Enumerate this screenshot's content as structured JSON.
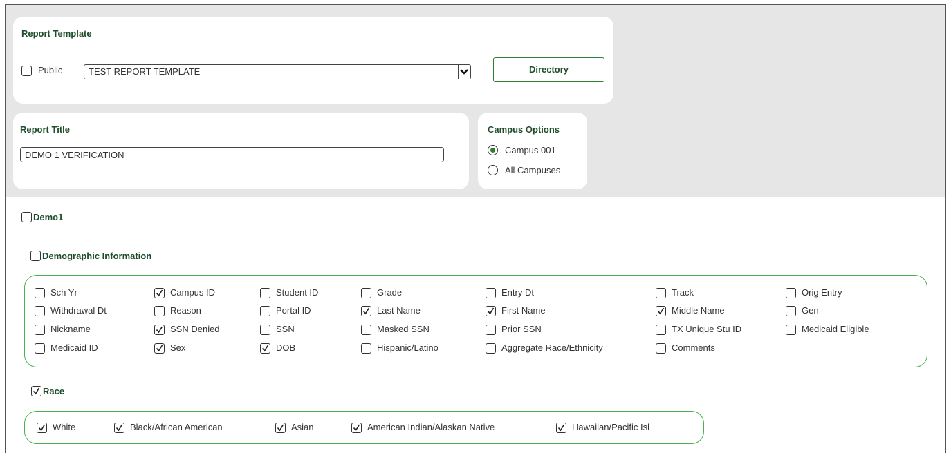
{
  "report_template": {
    "heading": "Report Template",
    "public_label": "Public",
    "public_checked": false,
    "selected_template": "TEST REPORT TEMPLATE",
    "directory_button": "Directory"
  },
  "report_title": {
    "heading": "Report Title",
    "value": "DEMO 1 VERIFICATION"
  },
  "campus_options": {
    "heading": "Campus Options",
    "options": [
      {
        "label": "Campus 001",
        "selected": true
      },
      {
        "label": "All Campuses",
        "selected": false
      }
    ]
  },
  "demo1": {
    "label": "Demo1",
    "checked": false,
    "demographic": {
      "label": "Demographic Information",
      "checked": false,
      "fields": [
        {
          "label": "Sch Yr",
          "checked": false
        },
        {
          "label": "Campus ID",
          "checked": true
        },
        {
          "label": "Student ID",
          "checked": false
        },
        {
          "label": "Grade",
          "checked": false
        },
        {
          "label": "Entry Dt",
          "checked": false
        },
        {
          "label": "Track",
          "checked": false
        },
        {
          "label": "Orig Entry",
          "checked": false
        },
        {
          "label": "Withdrawal Dt",
          "checked": false
        },
        {
          "label": "Reason",
          "checked": false
        },
        {
          "label": "Portal ID",
          "checked": false
        },
        {
          "label": "Last Name",
          "checked": true
        },
        {
          "label": "First Name",
          "checked": true
        },
        {
          "label": "Middle Name",
          "checked": true
        },
        {
          "label": "Gen",
          "checked": false
        },
        {
          "label": "Nickname",
          "checked": false
        },
        {
          "label": "SSN Denied",
          "checked": true
        },
        {
          "label": "SSN",
          "checked": false
        },
        {
          "label": "Masked SSN",
          "checked": false
        },
        {
          "label": "Prior SSN",
          "checked": false
        },
        {
          "label": "TX Unique Stu ID",
          "checked": false
        },
        {
          "label": "Medicaid Eligible",
          "checked": false
        },
        {
          "label": "Medicaid ID",
          "checked": false
        },
        {
          "label": "Sex",
          "checked": true
        },
        {
          "label": "DOB",
          "checked": true
        },
        {
          "label": "Hispanic/Latino",
          "checked": false
        },
        {
          "label": "Aggregate Race/Ethnicity",
          "checked": false
        },
        {
          "label": "Comments",
          "checked": false
        }
      ]
    },
    "race": {
      "label": "Race",
      "checked": true,
      "fields": [
        {
          "label": "White",
          "checked": true
        },
        {
          "label": "Black/African American",
          "checked": true
        },
        {
          "label": "Asian",
          "checked": true
        },
        {
          "label": "American Indian/Alaskan Native",
          "checked": true
        },
        {
          "label": "Hawaiian/Pacific Isl",
          "checked": true
        }
      ]
    }
  },
  "icons": {
    "checkmark": "checkmark-icon",
    "dropdown": "chevron-down-icon"
  },
  "colors": {
    "accent_green": "#2e7d32",
    "group_border": "#4caf50",
    "heading_text": "#1f4d2b",
    "background": "#e6e6e6"
  }
}
